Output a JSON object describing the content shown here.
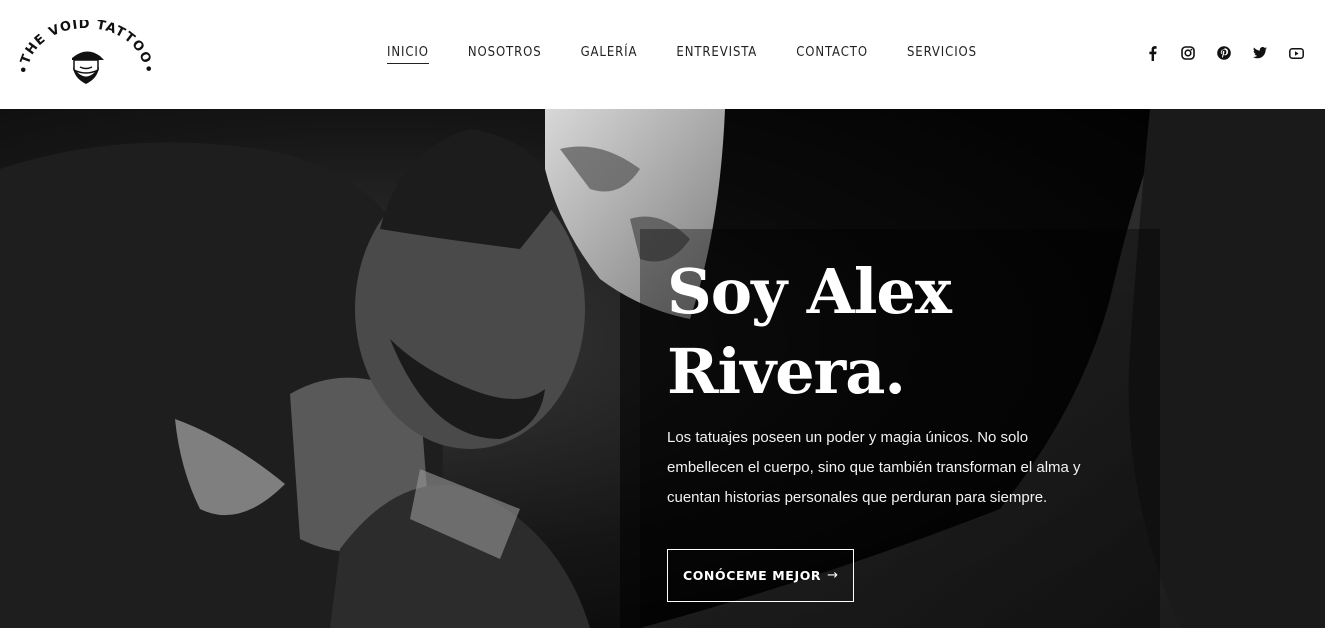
{
  "brand": {
    "logo_text": "THE VOID TATTOO"
  },
  "nav": {
    "items": [
      {
        "label": "INICIO",
        "active": true
      },
      {
        "label": "NOSOTROS",
        "active": false
      },
      {
        "label": "GALERÍA",
        "active": false
      },
      {
        "label": "ENTREVISTA",
        "active": false
      },
      {
        "label": "CONTACTO",
        "active": false
      },
      {
        "label": "SERVICIOS",
        "active": false
      }
    ]
  },
  "social": {
    "icons": [
      "facebook-icon",
      "instagram-icon",
      "pinterest-icon",
      "twitter-icon",
      "youtube-icon"
    ]
  },
  "hero": {
    "headline_line1": "Soy Alex",
    "headline_line2": "Rivera.",
    "body_line1": "Los tatuajes poseen un poder y magia únicos. No solo",
    "body_line2": "embellecen el cuerpo, sino que también transforman el alma y",
    "body_line3": "cuentan historias personales que perduran para siempre.",
    "cta_label": "CONÓCEME MEJOR",
    "cta_arrow": "→"
  },
  "colors": {
    "text_dark": "#222222",
    "hero_bg": "#0b0b0b",
    "white": "#ffffff"
  }
}
